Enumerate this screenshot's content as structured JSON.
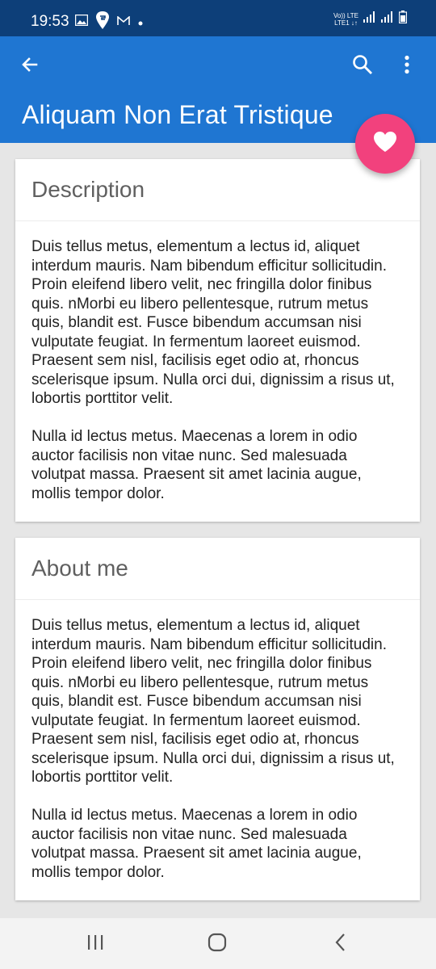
{
  "status_bar": {
    "time": "19:53",
    "network_top": "Vo)) LTE",
    "network_bottom": "LTE1 ↓↑",
    "left_icons": [
      "image-icon",
      "swiggy-icon",
      "gmail-icon",
      "dot-icon"
    ],
    "right_icons": [
      "signal-icon",
      "signal-icon",
      "battery-icon"
    ]
  },
  "app_bar": {
    "title": "Aliquam Non Erat Tristique",
    "color": "#1f76d2"
  },
  "fab": {
    "icon": "heart-icon",
    "color": "#f2417d"
  },
  "cards": [
    {
      "title": "Description",
      "paragraphs": [
        "Duis tellus metus, elementum a lectus id, aliquet interdum mauris. Nam bibendum efficitur sollicitudin. Proin eleifend libero velit, nec fringilla dolor finibus quis. nMorbi eu libero pellentesque, rutrum metus quis, blandit est. Fusce bibendum accumsan nisi vulputate feugiat. In fermentum laoreet euismod. Praesent sem nisl, facilisis eget odio at, rhoncus scelerisque ipsum. Nulla orci dui, dignissim a risus ut, lobortis porttitor velit.",
        "Nulla id lectus metus. Maecenas a lorem in odio auctor facilisis non vitae nunc. Sed malesuada volutpat massa. Praesent sit amet lacinia augue, mollis tempor dolor."
      ]
    },
    {
      "title": "About me",
      "paragraphs": [
        "Duis tellus metus, elementum a lectus id, aliquet interdum mauris. Nam bibendum efficitur sollicitudin. Proin eleifend libero velit, nec fringilla dolor finibus quis. nMorbi eu libero pellentesque, rutrum metus quis, blandit est. Fusce bibendum accumsan nisi vulputate feugiat. In fermentum laoreet euismod. Praesent sem nisl, facilisis eget odio at, rhoncus scelerisque ipsum. Nulla orci dui, dignissim a risus ut, lobortis porttitor velit.",
        "Nulla id lectus metus. Maecenas a lorem in odio auctor facilisis non vitae nunc. Sed malesuada volutpat massa. Praesent sit amet lacinia augue, mollis tempor dolor."
      ]
    }
  ],
  "nav_bar": {
    "buttons": [
      "recents-icon",
      "home-icon",
      "back-icon"
    ]
  }
}
